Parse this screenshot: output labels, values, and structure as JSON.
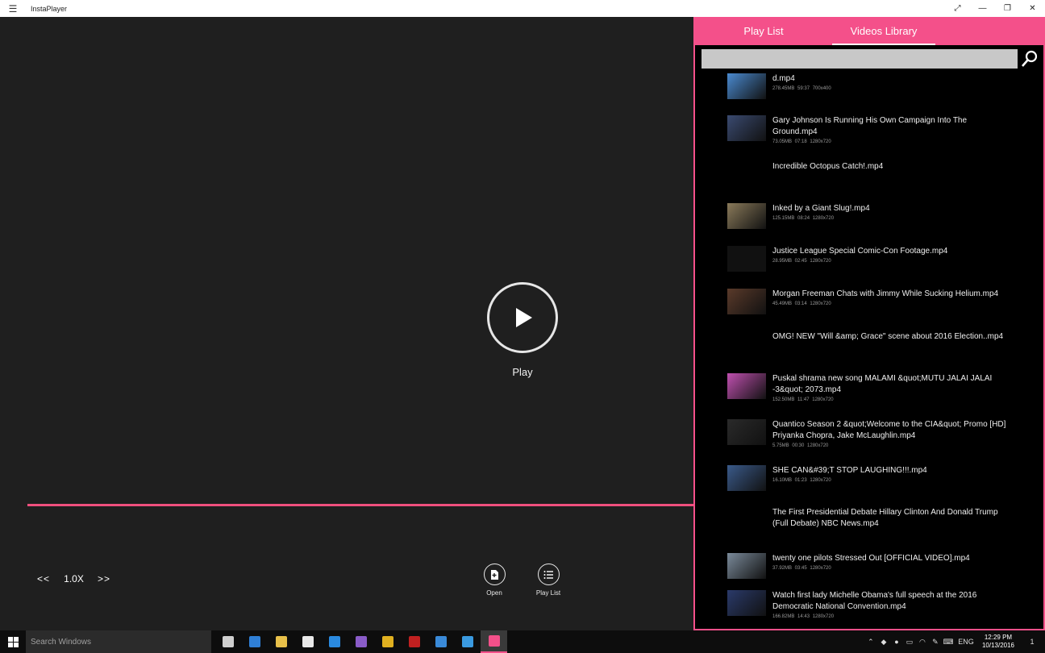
{
  "window": {
    "title": "InstaPlayer",
    "hamburger": "☰",
    "controls": {
      "fullscreen": "⤢",
      "minimize": "—",
      "restore": "❐",
      "close": "✕"
    }
  },
  "player": {
    "play_label": "Play",
    "progress_percent": 100,
    "rewind_label": "<<",
    "speed": "1.0X",
    "forward_label": ">>",
    "open_label": "Open",
    "playlist_label": "Play List"
  },
  "panel": {
    "tabs": [
      {
        "label": "Play List",
        "active": false
      },
      {
        "label": "Videos Library",
        "active": true
      }
    ],
    "search": {
      "value": "",
      "placeholder": ""
    },
    "items": [
      {
        "title": "d.mp4",
        "meta": "278.45MB 59:37 700x400",
        "thumb": "#4a8ad0"
      },
      {
        "title": "Gary Johnson Is Running His Own Campaign Into The Ground.mp4",
        "meta": "73.05MB 07:18 1280x720",
        "thumb": "#3a4a70"
      },
      {
        "title": "Incredible Octopus Catch!.mp4",
        "meta": "",
        "thumb": ""
      },
      {
        "title": "Inked by a Giant Slug!.mp4",
        "meta": "125.15MB 08:24 1280x720",
        "thumb": "#8a7a5a"
      },
      {
        "title": "Justice League Special Comic-Con Footage.mp4",
        "meta": "28.95MB 02:45 1280x720",
        "thumb": "#111111"
      },
      {
        "title": "Morgan Freeman Chats with Jimmy While Sucking Helium.mp4",
        "meta": "45.49MB 03:14 1280x720",
        "thumb": "#5a3a2a"
      },
      {
        "title": "OMG! NEW \"Will &amp; Grace\" scene about 2016 Election..mp4",
        "meta": "",
        "thumb": ""
      },
      {
        "title": "Puskal shrama new song MALAMI &quot;MUTU JALAI JALAI -3&quot; 2073.mp4",
        "meta": "152.50MB 11:47 1280x720",
        "thumb": "#c050b0"
      },
      {
        "title": "Quantico Season 2 &quot;Welcome to the CIA&quot; Promo [HD] Priyanka Chopra, Jake McLaughlin.mp4",
        "meta": "5.75MB 00:30 1280x720",
        "thumb": "#2a2a2a"
      },
      {
        "title": "SHE CAN&#39;T STOP LAUGHING!!!.mp4",
        "meta": "16.10MB 01:23 1280x720",
        "thumb": "#3a5a8a"
      },
      {
        "title": "The First Presidential Debate Hillary Clinton And Donald Trump (Full Debate)  NBC News.mp4",
        "meta": "",
        "thumb": ""
      },
      {
        "title": "twenty one pilots Stressed Out [OFFICIAL VIDEO].mp4",
        "meta": "37.92MB 03:45 1280x720",
        "thumb": "#7a8a9a"
      },
      {
        "title": "Watch first lady Michelle Obama's full speech at the 2016 Democratic National Convention.mp4",
        "meta": "166.82MB 14:43 1280x720",
        "thumb": "#2a3a6a"
      }
    ]
  },
  "taskbar": {
    "search_placeholder": "Search Windows",
    "apps": [
      {
        "name": "task-view-icon",
        "color": "#cfcfcf"
      },
      {
        "name": "edge-icon",
        "color": "#2f7fd6"
      },
      {
        "name": "file-explorer-icon",
        "color": "#e8c04a"
      },
      {
        "name": "store-icon",
        "color": "#e8e8e8"
      },
      {
        "name": "teamviewer-icon",
        "color": "#2a8ae0"
      },
      {
        "name": "visual-studio-icon",
        "color": "#8a5cc8"
      },
      {
        "name": "chrome-icon",
        "color": "#e0b020"
      },
      {
        "name": "app-red-icon",
        "color": "#c02020"
      },
      {
        "name": "app-blue-icon",
        "color": "#3a8ad8"
      },
      {
        "name": "app-globe-icon",
        "color": "#3a9ae0"
      },
      {
        "name": "instaplayer-icon",
        "color": "#f4508a"
      }
    ],
    "tray": {
      "lang": "ENG",
      "time": "12:29 PM",
      "date": "10/13/2016",
      "notification_count": "1"
    }
  },
  "colors": {
    "accent": "#f4508a",
    "background": "#1f1f1f",
    "panel": "#000000"
  }
}
